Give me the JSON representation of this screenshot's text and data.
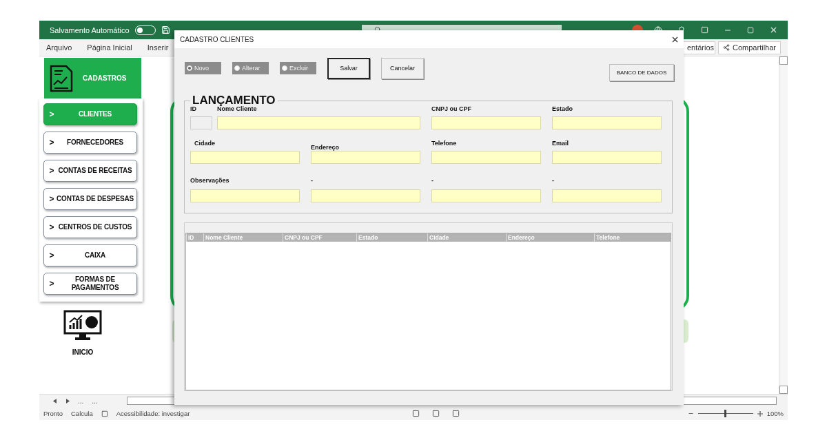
{
  "excel": {
    "autosave": {
      "label": "Salvamento Automático",
      "on": false
    },
    "ribbon_tabs": [
      {
        "label": "Arquivo"
      },
      {
        "label": "Página Inicial"
      },
      {
        "label": "Inserir"
      }
    ],
    "comments_button": "entários",
    "share_button": "Compartilhar",
    "sheet": {
      "header": "CADASTROS",
      "menu": [
        {
          "label": "CLIENTES",
          "selected": true
        },
        {
          "label": "FORNECEDORES",
          "selected": false
        },
        {
          "label": "CONTAS DE RECEITAS",
          "selected": false
        },
        {
          "label": "CONTAS DE DESPESAS",
          "selected": false
        },
        {
          "label": "CENTROS DE CUSTOS",
          "selected": false
        },
        {
          "label": "CAIXA",
          "selected": false
        },
        {
          "label": "FORMAS DE PAGAMENTOS",
          "selected": false
        }
      ],
      "menu_marker": ">",
      "home_label": "INICIO"
    },
    "sheet_nav": [
      "...",
      "..."
    ],
    "status_bar": {
      "items": [
        "Pronto",
        "Calcula"
      ],
      "accessibility": "Acessibilidade: investigar",
      "zoom": {
        "level": 0.5,
        "reading": "100%"
      }
    }
  },
  "dialog": {
    "title": "CADASTRO CLIENTES",
    "options": [
      {
        "label": "Novo",
        "selected": true,
        "disabled": true
      },
      {
        "label": "Alterar",
        "selected": false,
        "disabled": true
      },
      {
        "label": "Excluir",
        "selected": false,
        "disabled": true
      }
    ],
    "buttons": [
      {
        "label": "Salvar",
        "focused": true
      },
      {
        "label": "Cancelar",
        "focused": false
      }
    ],
    "db_button": "BANCO DE DADOS",
    "frame": {
      "title": "LANÇAMENTO",
      "id_label": "ID",
      "name_label": "Nome Cliente",
      "fields": [
        {
          "label": "CNPJ ou  CPF"
        },
        {
          "label": "Estado"
        },
        {
          "label": "Cidade"
        },
        {
          "label": "Endereço"
        },
        {
          "label": "Telefone"
        },
        {
          "label": "Email"
        },
        {
          "label": "Observações"
        },
        {
          "label": "-"
        },
        {
          "label": "-"
        },
        {
          "label": "-"
        }
      ]
    },
    "list": {
      "columns": [
        "ID",
        "Nome Cliente",
        "CNPJ ou  CPF",
        "Estado",
        "Cidade",
        "Endereço",
        "Telefone"
      ]
    }
  }
}
